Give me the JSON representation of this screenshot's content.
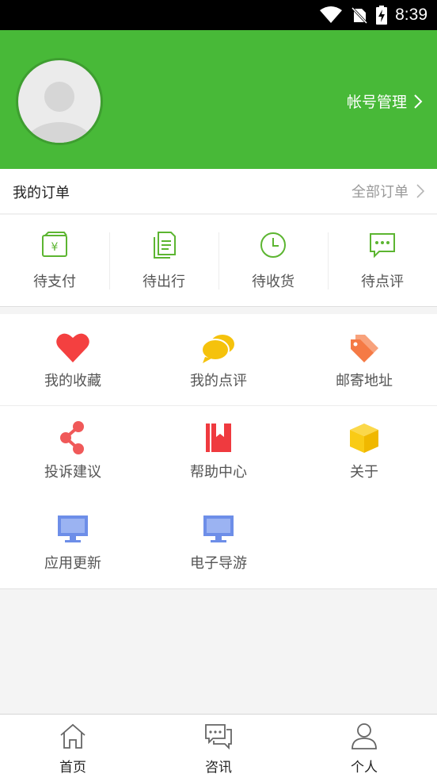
{
  "status_bar": {
    "time": "8:39"
  },
  "profile": {
    "account_label": "帐号管理"
  },
  "orders": {
    "title": "我的订单",
    "all_label": "全部订单",
    "items": [
      {
        "label": "待支付",
        "icon": "wallet-yen-icon"
      },
      {
        "label": "待出行",
        "icon": "document-icon"
      },
      {
        "label": "待收货",
        "icon": "clock-icon"
      },
      {
        "label": "待点评",
        "icon": "comment-icon"
      }
    ]
  },
  "features": [
    {
      "label": "我的收藏",
      "icon": "heart-icon"
    },
    {
      "label": "我的点评",
      "icon": "chat-bubbles-icon"
    },
    {
      "label": "邮寄地址",
      "icon": "tag-icon"
    },
    {
      "label": "投诉建议",
      "icon": "share-icon"
    },
    {
      "label": "帮助中心",
      "icon": "book-icon"
    },
    {
      "label": "关于",
      "icon": "box-icon"
    },
    {
      "label": "应用更新",
      "icon": "monitor-icon"
    },
    {
      "label": "电子导游",
      "icon": "monitor-icon"
    }
  ],
  "tabs": [
    {
      "label": "首页",
      "icon": "home-icon"
    },
    {
      "label": "咨讯",
      "icon": "chat-icon"
    },
    {
      "label": "个人",
      "icon": "person-icon"
    }
  ],
  "colors": {
    "header_green": "#48b938",
    "order_icon_green": "#5cb531",
    "heart_red": "#f44040",
    "bubble_yellow": "#f5c20c",
    "tag_orange": "#f57a45",
    "share_red": "#f05959",
    "book_red": "#ef3a3f",
    "box_yellow": "#f9cb16",
    "monitor_blue": "#6d8ee8"
  }
}
